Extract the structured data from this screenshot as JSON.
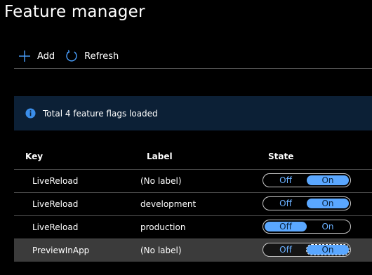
{
  "page": {
    "title": "Feature manager"
  },
  "toolbar": {
    "add_label": "Add",
    "refresh_label": "Refresh",
    "add_icon": "plus-icon",
    "refresh_icon": "refresh-icon"
  },
  "banner": {
    "icon": "info-icon",
    "text": "Total 4 feature flags loaded"
  },
  "table": {
    "columns": [
      "Key",
      "Label",
      "State"
    ],
    "rows": [
      {
        "key": "LiveReload",
        "label": "(No label)",
        "state": "On",
        "selected": false
      },
      {
        "key": "LiveReload",
        "label": "development",
        "state": "On",
        "selected": false
      },
      {
        "key": "LiveReload",
        "label": "production",
        "state": "Off",
        "selected": false
      },
      {
        "key": "PreviewInApp",
        "label": "(No label)",
        "state": "On",
        "selected": true
      }
    ],
    "toggle_labels": {
      "off": "Off",
      "on": "On"
    }
  },
  "colors": {
    "background": "#000000",
    "accent": "#5aa7ff",
    "banner_bg": "#0c2036",
    "info_icon": "#3b8eea",
    "selected_row": "#3b3b3b"
  }
}
